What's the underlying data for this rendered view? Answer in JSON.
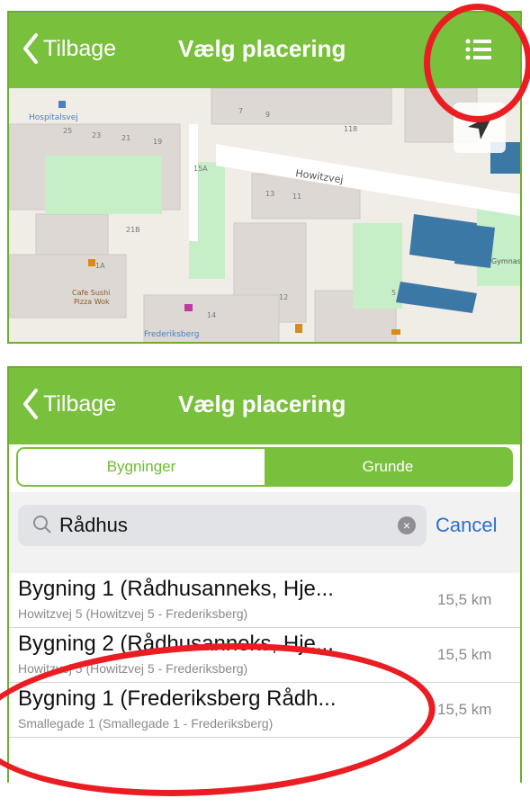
{
  "top_screen": {
    "navbar": {
      "back_label": "Tilbage",
      "title": "Vælg placering",
      "list_icon": "list-icon"
    },
    "map": {
      "street_label": "Howitzvej",
      "place_labels": [
        "Hospitalsvej",
        "Frederiksberg",
        "Cafe Sushi",
        "Pizza Wok",
        "Gymnasiet"
      ],
      "house_numbers": [
        "25",
        "23",
        "21",
        "19",
        "15A",
        "13",
        "11",
        "21B",
        "1A",
        "5",
        "7",
        "9",
        "118",
        "14",
        "12"
      ],
      "locate_icon": "location-arrow-icon"
    }
  },
  "bottom_screen": {
    "navbar": {
      "back_label": "Tilbage",
      "title": "Vælg placering"
    },
    "segments": {
      "active": "Bygninger",
      "inactive": "Grunde"
    },
    "search": {
      "value": "Rådhus",
      "cancel_label": "Cancel"
    },
    "results": [
      {
        "name": "Bygning 1 (Rådhusanneks, Hje...",
        "address": "Howitzvej 5 (Howitzvej 5 - Frederiksberg)",
        "distance": "15,5 km"
      },
      {
        "name": "Bygning 2 (Rådhusanneks, Hje...",
        "address": "Howitzvej 5 (Howitzvej 5 - Frederiksberg)",
        "distance": "15,5 km"
      },
      {
        "name": "Bygning 1 (Frederiksberg Rådh...",
        "address": "Smallegade 1 (Smallegade 1 - Frederiksberg)",
        "distance": "15,5 km"
      }
    ]
  },
  "colors": {
    "accent_green": "#79c03d",
    "highlight_red": "#ea1d22",
    "link_blue": "#2d6fcc",
    "building_blue": "#3c78a6"
  }
}
